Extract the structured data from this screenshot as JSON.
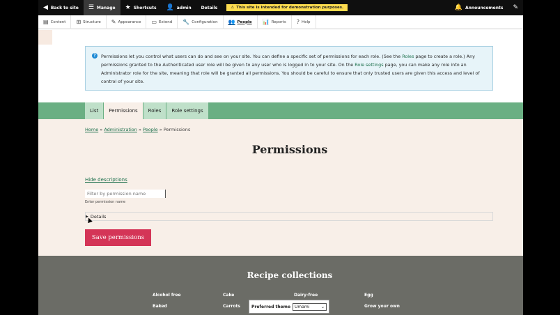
{
  "toolbar": {
    "back_to_site": "Back to site",
    "manage": "Manage",
    "shortcuts": "Shortcuts",
    "user": "admin",
    "details": "Details",
    "warning": "This site is intended for demonstration purposes.",
    "announcements": "Announcements"
  },
  "tray": {
    "items": [
      {
        "label": "Content",
        "icon": "content-icon"
      },
      {
        "label": "Structure",
        "icon": "structure-icon"
      },
      {
        "label": "Appearance",
        "icon": "appearance-icon"
      },
      {
        "label": "Extend",
        "icon": "extend-icon"
      },
      {
        "label": "Configuration",
        "icon": "configuration-icon"
      },
      {
        "label": "People",
        "icon": "people-icon"
      },
      {
        "label": "Reports",
        "icon": "reports-icon"
      },
      {
        "label": "Help",
        "icon": "help-icon"
      }
    ],
    "active": "People"
  },
  "message": {
    "part1": "Permissions let you control what users can do and see on your site. You can define a specific set of permissions for each role. (See the ",
    "roles_link": "Roles",
    "part2": " page to create a role.) Any permissions granted to the Authenticated user role will be given to any user who is logged in to your site. On the ",
    "role_settings_link": "Role settings",
    "part3": " page, you can make any role into an Administrator role for the site, meaning that role will be granted all permissions. You should be careful to ensure that only trusted users are given this access and level of control of your site."
  },
  "tabs": [
    {
      "label": "List"
    },
    {
      "label": "Permissions"
    },
    {
      "label": "Roles"
    },
    {
      "label": "Role settings"
    }
  ],
  "active_tab": "Permissions",
  "breadcrumb": {
    "home": "Home",
    "administration": "Administration",
    "people": "People",
    "current": "Permissions",
    "separator": "»"
  },
  "page_title": "Permissions",
  "hide_descriptions": "Hide descriptions",
  "filter": {
    "placeholder": "Filter by permission name",
    "value": "",
    "description": "Enter permission name"
  },
  "details_label": "Details",
  "save_button": "Save permissions",
  "footer": {
    "title": "Recipe collections",
    "links": [
      "Alcohol free",
      "Cake",
      "Dairy-free",
      "Egg",
      "Baked",
      "Carrots",
      "Grow your own"
    ]
  },
  "theme_switcher": {
    "label": "Preferred theme",
    "selected": "Umami"
  },
  "colors": {
    "tabs_bar": "#6aaf83",
    "main_bg": "#f8efe8",
    "save_button": "#d43557",
    "footer_bg": "#6b6c66",
    "warning_bg": "#fddc4f",
    "link": "#1a6e4a"
  }
}
